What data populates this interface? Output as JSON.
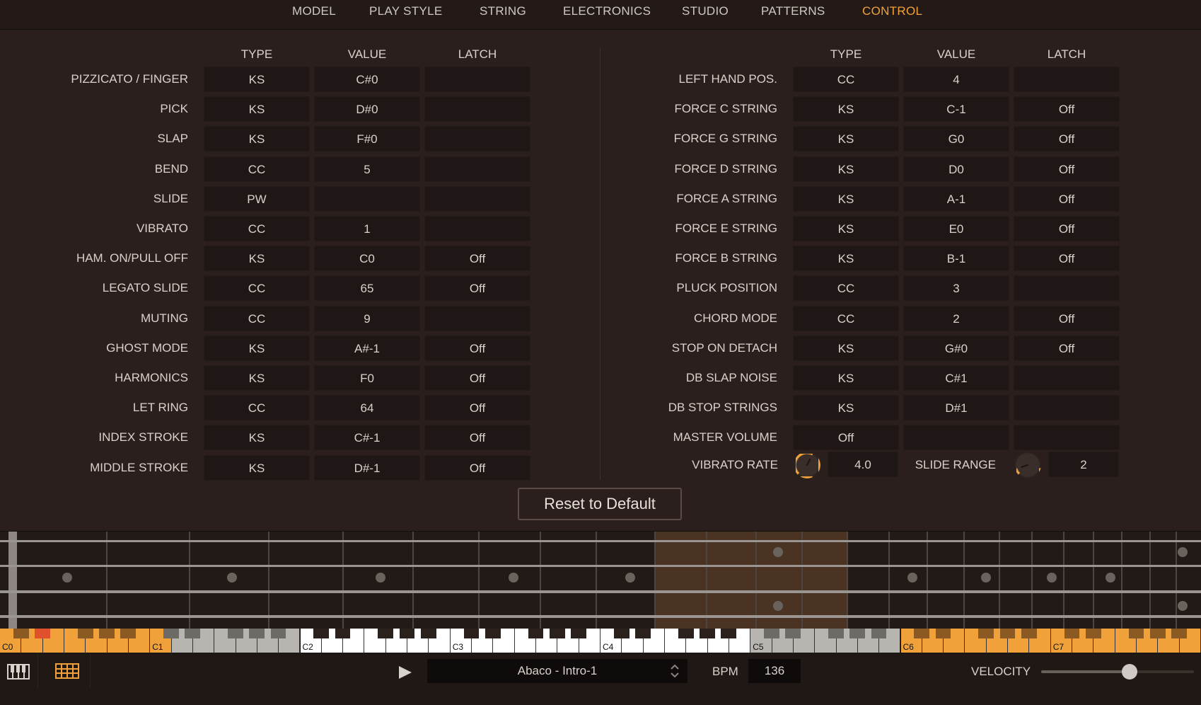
{
  "nav": {
    "tabs": [
      "MODEL",
      "PLAY STYLE",
      "STRING",
      "ELECTRONICS",
      "STUDIO",
      "PATTERNS",
      "CONTROL"
    ],
    "active": "CONTROL",
    "accent_color": "#f0a13a"
  },
  "left_table": {
    "headers": [
      "TYPE",
      "VALUE",
      "LATCH"
    ],
    "rows": [
      {
        "label": "PIZZICATO / FINGER",
        "type": "KS",
        "value": "C#0",
        "latch": ""
      },
      {
        "label": "PICK",
        "type": "KS",
        "value": "D#0",
        "latch": ""
      },
      {
        "label": "SLAP",
        "type": "KS",
        "value": "F#0",
        "latch": ""
      },
      {
        "label": "BEND",
        "type": "CC",
        "value": "5",
        "latch": ""
      },
      {
        "label": "SLIDE",
        "type": "PW",
        "value": "",
        "latch": ""
      },
      {
        "label": "VIBRATO",
        "type": "CC",
        "value": "1",
        "latch": ""
      },
      {
        "label": "HAM. ON/PULL OFF",
        "type": "KS",
        "value": "C0",
        "latch": "Off"
      },
      {
        "label": "LEGATO SLIDE",
        "type": "CC",
        "value": "65",
        "latch": "Off"
      },
      {
        "label": "MUTING",
        "type": "CC",
        "value": "9",
        "latch": ""
      },
      {
        "label": "GHOST MODE",
        "type": "KS",
        "value": "A#-1",
        "latch": "Off"
      },
      {
        "label": "HARMONICS",
        "type": "KS",
        "value": "F0",
        "latch": "Off"
      },
      {
        "label": "LET RING",
        "type": "CC",
        "value": "64",
        "latch": "Off"
      },
      {
        "label": "INDEX STROKE",
        "type": "KS",
        "value": "C#-1",
        "latch": "Off"
      },
      {
        "label": "MIDDLE STROKE",
        "type": "KS",
        "value": "D#-1",
        "latch": "Off"
      }
    ]
  },
  "right_table": {
    "headers": [
      "TYPE",
      "VALUE",
      "LATCH"
    ],
    "rows": [
      {
        "label": "LEFT HAND POS.",
        "type": "CC",
        "value": "4",
        "latch": ""
      },
      {
        "label": "FORCE C STRING",
        "type": "KS",
        "value": "C-1",
        "latch": "Off"
      },
      {
        "label": "FORCE G STRING",
        "type": "KS",
        "value": "G0",
        "latch": "Off"
      },
      {
        "label": "FORCE D STRING",
        "type": "KS",
        "value": "D0",
        "latch": "Off"
      },
      {
        "label": "FORCE A STRING",
        "type": "KS",
        "value": "A-1",
        "latch": "Off"
      },
      {
        "label": "FORCE E STRING",
        "type": "KS",
        "value": "E0",
        "latch": "Off"
      },
      {
        "label": "FORCE B STRING",
        "type": "KS",
        "value": "B-1",
        "latch": "Off"
      },
      {
        "label": "PLUCK POSITION",
        "type": "CC",
        "value": "3",
        "latch": ""
      },
      {
        "label": "CHORD MODE",
        "type": "CC",
        "value": "2",
        "latch": "Off"
      },
      {
        "label": "STOP ON DETACH",
        "type": "KS",
        "value": "G#0",
        "latch": "Off"
      },
      {
        "label": "DB SLAP NOISE",
        "type": "KS",
        "value": "C#1",
        "latch": ""
      },
      {
        "label": "DB STOP STRINGS",
        "type": "KS",
        "value": "D#1",
        "latch": ""
      },
      {
        "label": "MASTER VOLUME",
        "type": "Off",
        "value": "",
        "latch": ""
      }
    ],
    "vibrato_rate": {
      "label": "VIBRATO RATE",
      "value": "4.0",
      "knob_level": 0.6
    },
    "slide_range": {
      "label": "SLIDE RANGE",
      "value": "2",
      "knob_level": 0.1
    }
  },
  "reset_button": "Reset to Default",
  "keyboard": {
    "octave_labels": [
      "C0",
      "C1",
      "C2",
      "C3",
      "C4",
      "C5",
      "C6",
      "C7"
    ],
    "orange_color": "#f0a13a",
    "pressed_color": "#e0502a"
  },
  "transport": {
    "preset": "Abaco - Intro-1",
    "bpm_label": "BPM",
    "bpm": "136",
    "velocity_label": "VELOCITY",
    "velocity_level": 0.58
  },
  "icons": [
    "keyboard-icon",
    "grid-icon",
    "play-icon",
    "preset-arrows-icon"
  ]
}
